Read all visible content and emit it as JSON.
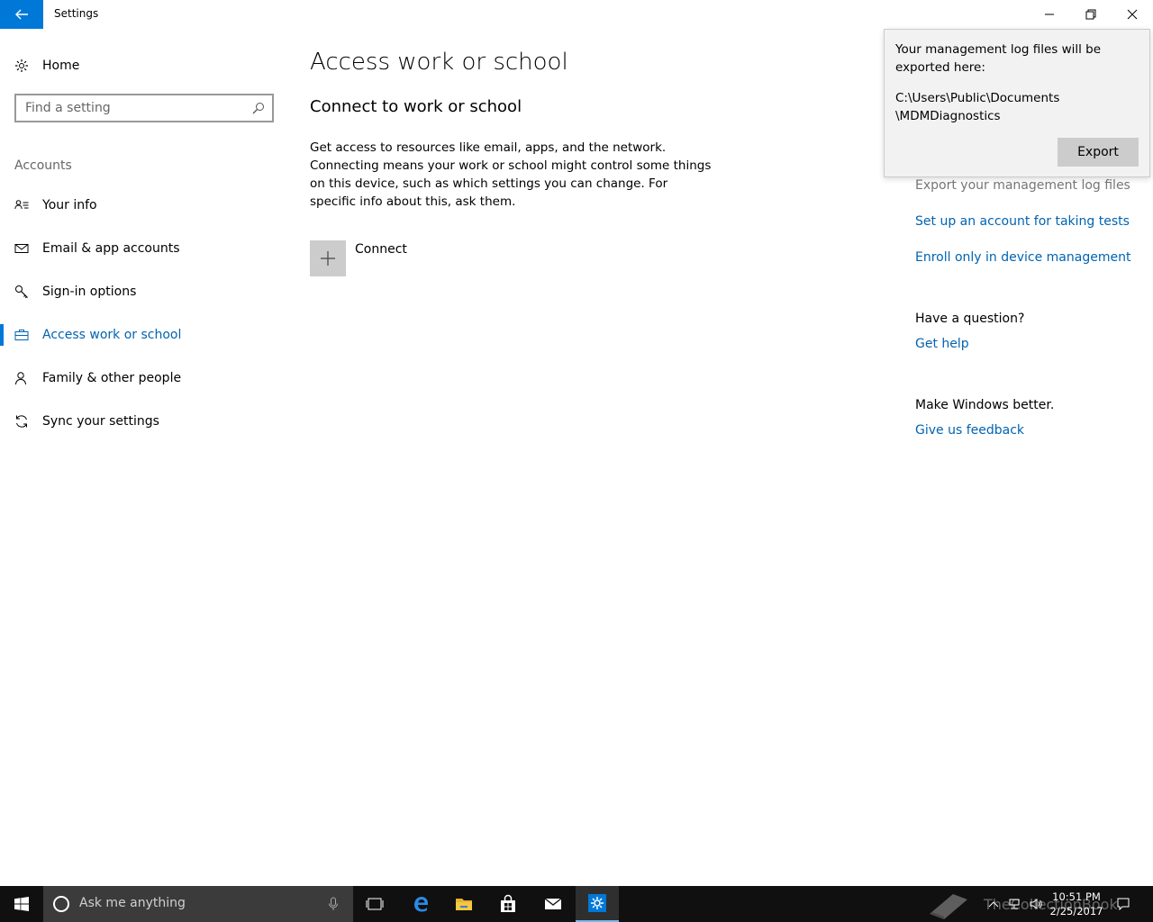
{
  "window": {
    "title": "Settings",
    "accent": "#0078d7"
  },
  "sidebar": {
    "home_label": "Home",
    "search_placeholder": "Find a setting",
    "section_label": "Accounts",
    "items": [
      {
        "label": "Your info",
        "icon": "contact-card-icon"
      },
      {
        "label": "Email & app accounts",
        "icon": "mail-icon"
      },
      {
        "label": "Sign-in options",
        "icon": "key-icon"
      },
      {
        "label": "Access work or school",
        "icon": "briefcase-icon",
        "active": true
      },
      {
        "label": "Family & other people",
        "icon": "person-icon"
      },
      {
        "label": "Sync your settings",
        "icon": "sync-icon"
      }
    ]
  },
  "main": {
    "title": "Access work or school",
    "subtitle": "Connect to work or school",
    "description": "Get access to resources like email, apps, and the network. Connecting means your work or school might control some things on this device, such as which settings you can change. For specific info about this, ask them.",
    "connect_label": "Connect"
  },
  "related": {
    "export_logs": "Export your management log files",
    "setup_test_account": "Set up an account for taking tests",
    "enroll_device": "Enroll only in device management",
    "question_heading": "Have a question?",
    "get_help": "Get help",
    "feedback_heading": "Make Windows better.",
    "give_feedback": "Give us feedback"
  },
  "flyout": {
    "message": "Your management log files will be exported here:",
    "path_line1": "C:\\Users\\Public\\Documents",
    "path_line2": "\\MDMDiagnostics",
    "export_label": "Export"
  },
  "taskbar": {
    "search_placeholder": "Ask me anything",
    "watermark": "TheCollectionBook",
    "time": "10:51 PM",
    "date": "2/25/2017"
  }
}
